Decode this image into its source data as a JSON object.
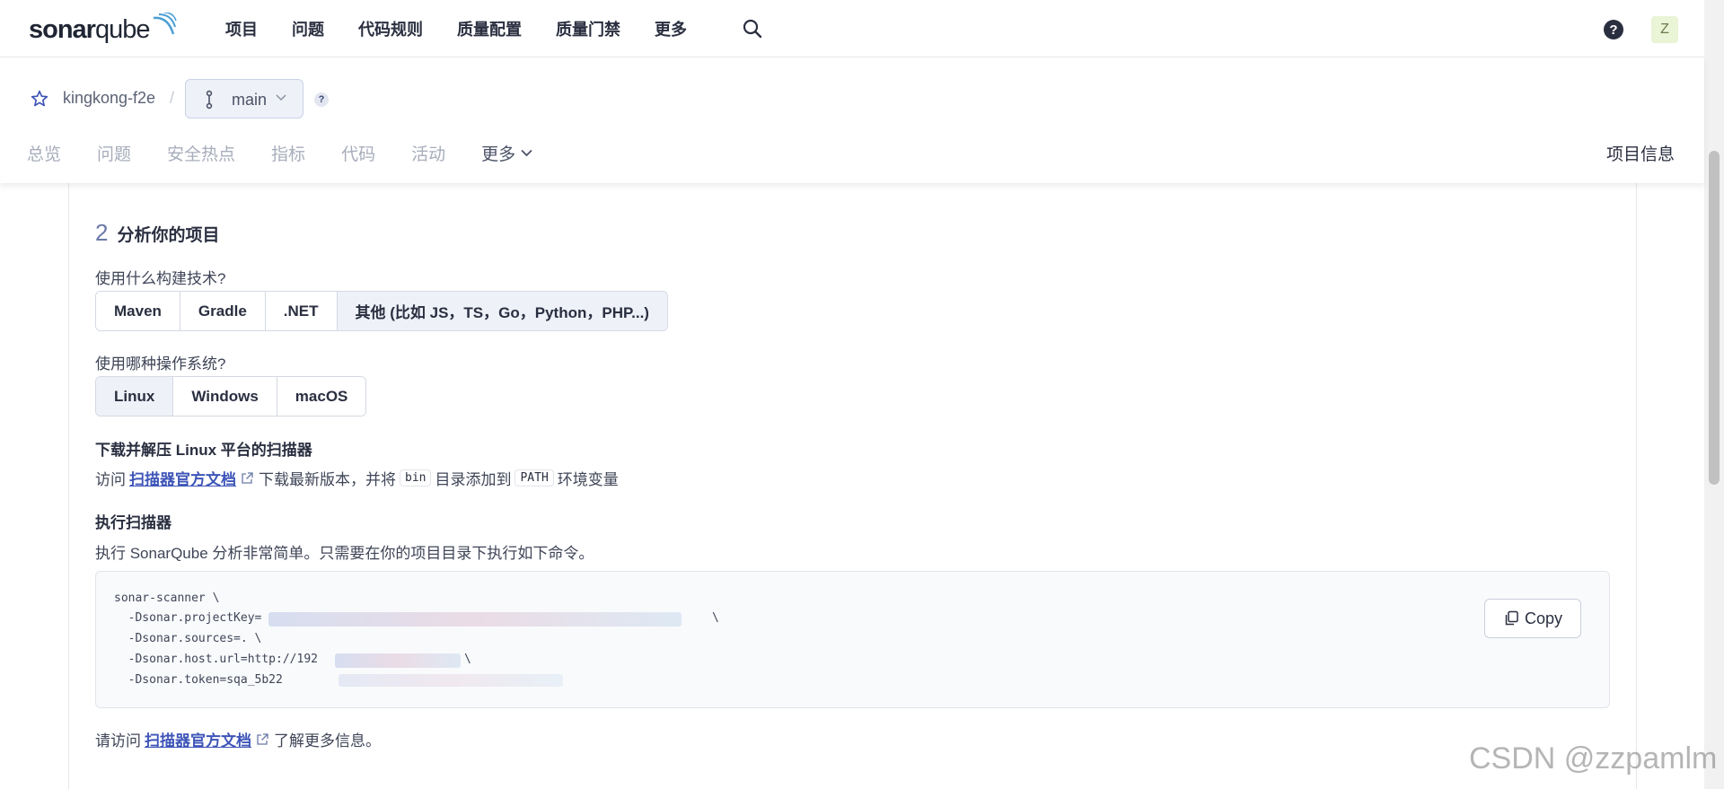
{
  "brand": {
    "logo_text_bold": "sonar",
    "logo_text_light": "qube"
  },
  "nav": {
    "items": [
      "项目",
      "问题",
      "代码规则",
      "质量配置",
      "质量门禁",
      "更多"
    ]
  },
  "user": {
    "avatar_letter": "Z",
    "help_glyph": "?"
  },
  "project": {
    "name": "kingkong-f2e",
    "separator": "/",
    "branch": "main",
    "help_glyph": "?",
    "tabs": [
      "总览",
      "问题",
      "安全热点",
      "指标",
      "代码",
      "活动"
    ],
    "more_tab": "更多",
    "info_link": "项目信息"
  },
  "step": {
    "number": "2",
    "title": "分析你的项目",
    "build_question": "使用什么构建技术?",
    "build_options": [
      "Maven",
      "Gradle",
      ".NET",
      "其他 (比如 JS，TS，Go，Python，PHP...)"
    ],
    "build_selected": 3,
    "os_question": "使用哪种操作系统?",
    "os_options": [
      "Linux",
      "Windows",
      "macOS"
    ],
    "os_selected": 0,
    "download_title": "下载并解压 Linux 平台的扫描器",
    "download_prefix": "访问",
    "download_link": "扫描器官方文档",
    "download_middle": "下载最新版本，并将",
    "bin_code": "bin",
    "download_middle2": "目录添加到",
    "path_code": "PATH",
    "download_suffix": "环境变量",
    "run_title": "执行扫描器",
    "run_desc": "执行 SonarQube 分析非常简单。只需要在你的项目目录下执行如下命令。",
    "code_lines": [
      "sonar-scanner \\",
      "  -Dsonar.projectKey=",
      "  -Dsonar.sources=. \\",
      "  -Dsonar.host.url=http://192",
      "  -Dsonar.token=sqa_5b22"
    ],
    "code_line2_tail": "\\",
    "code_line4_tail": "\\",
    "copy_label": "Copy",
    "footer_prefix": "请访问",
    "footer_link": "扫描器官方文档",
    "footer_suffix": "了解更多信息。"
  },
  "watermark": "CSDN @zzpamlm",
  "colors": {
    "accent": "#3e55b8",
    "selected_bg": "#eef1f8",
    "text": "#2a2f40"
  }
}
